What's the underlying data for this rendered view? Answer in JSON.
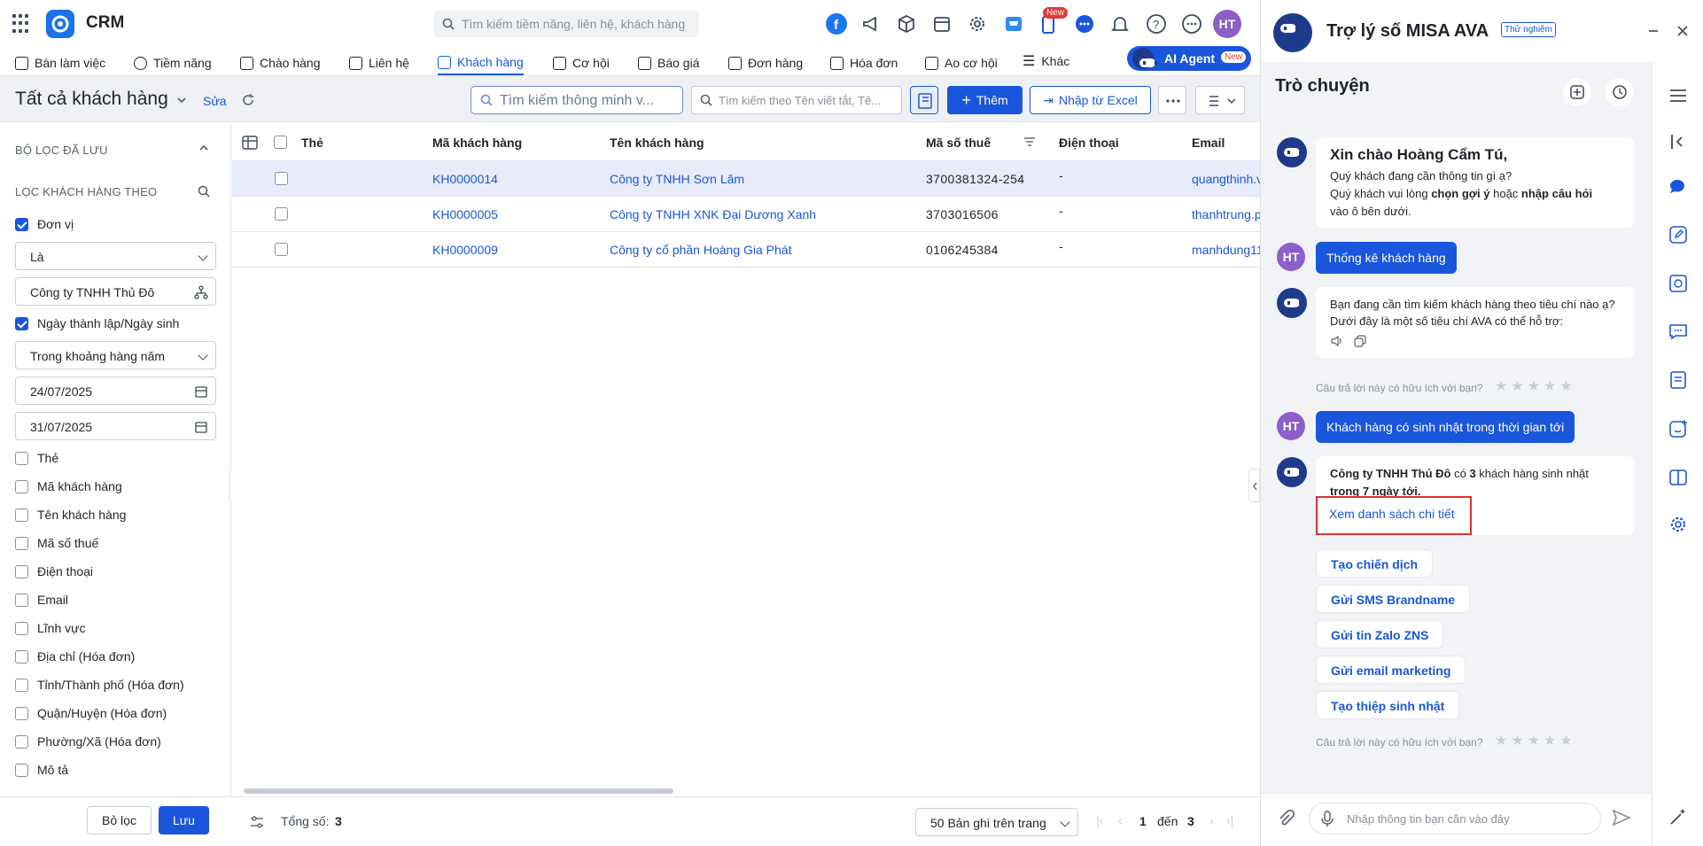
{
  "header": {
    "app_name": "CRM",
    "search_placeholder": "Tìm kiếm tiềm năng, liên hệ, khách hàng",
    "new_badge": "New",
    "avatar_initials": "HT"
  },
  "nav": {
    "items": [
      {
        "label": "Bàn làm việc"
      },
      {
        "label": "Tiềm năng"
      },
      {
        "label": "Chào hàng"
      },
      {
        "label": "Liên hệ"
      },
      {
        "label": "Khách hàng"
      },
      {
        "label": "Cơ hội"
      },
      {
        "label": "Báo giá"
      },
      {
        "label": "Đơn hàng"
      },
      {
        "label": "Hóa đơn"
      },
      {
        "label": "Ao cơ hội"
      },
      {
        "label": "Khác"
      }
    ],
    "active": "Khách hàng",
    "ai_agent_label": "AI Agent",
    "ai_agent_badge": "New"
  },
  "toolbar": {
    "title": "Tất cả khách hàng",
    "edit_label": "Sửa",
    "smart_search_placeholder": "Tìm kiếm thông minh v...",
    "search_placeholder": "Tìm kiếm theo Tên viết tắt, Tê...",
    "add_label": "Thêm",
    "import_label": "Nhập từ Excel"
  },
  "sidebar": {
    "saved_filters_title": "BỘ LỌC ĐÃ LƯU",
    "filter_by_title": "LỌC KHÁCH HÀNG THEO",
    "unit_label": "Đơn vị",
    "unit_operator": "Là",
    "unit_value": "Công ty TNHH Thủ Đô",
    "date_label": "Ngày thành lập/Ngày sinh",
    "date_operator": "Trong khoảng hàng năm",
    "date_from": "24/07/2025",
    "date_to": "31/07/2025",
    "fields": [
      "Thẻ",
      "Mã khách hàng",
      "Tên khách hàng",
      "Mã số thuế",
      "Điện thoại",
      "Email",
      "Lĩnh vực",
      "Địa chỉ (Hóa đơn)",
      "Tỉnh/Thành phố (Hóa đơn)",
      "Quận/Huyện (Hóa đơn)",
      "Phường/Xã (Hóa đơn)",
      "Mô tả"
    ],
    "reset_label": "Bỏ lọc",
    "save_label": "Lưu"
  },
  "table": {
    "columns": [
      "Thẻ",
      "Mã khách hàng",
      "Tên khách hàng",
      "Mã số thuế",
      "Điện thoại",
      "Email"
    ],
    "rows": [
      {
        "code": "KH0000014",
        "name": "Công ty TNHH Sơn Lâm",
        "tax": "3700381324-254",
        "phone": "-",
        "email": "quangthinh.v"
      },
      {
        "code": "KH0000005",
        "name": "Công ty TNHH XNK Đại Dương Xanh",
        "tax": "3703016506",
        "phone": "-",
        "email": "thanhtrung.p"
      },
      {
        "code": "KH0000009",
        "name": "Công ty cổ phần Hoàng Gia Phát",
        "tax": "0106245384",
        "phone": "-",
        "email": "manhdung11"
      }
    ],
    "total_label": "Tổng số:",
    "total": "3",
    "page_size": "50 Bản ghi trên trang",
    "page_from": "1",
    "page_to_label": "đến",
    "page_to": "3"
  },
  "assistant": {
    "title": "Trợ lý số MISA AVA",
    "beta_badge": "Thử nghiệm",
    "section_title": "Trò chuyện",
    "greeting_title": "Xin chào Hoàng Cẩm Tú,",
    "greeting_line1": "Quý khách đang cần thông tin gì ạ?",
    "greeting_line2_a": "Quý khách vui lòng ",
    "greeting_line2_b": "chọn gợi ý",
    "greeting_line2_c": " hoặc ",
    "greeting_line2_d": "nhập câu hỏi",
    "greeting_line3": "vào ô bên dưới.",
    "user_msg1": "Thống kê khách hàng",
    "bot_msg1": "Bạn đang cần tìm kiếm khách hàng theo tiêu chí nào ạ? Dưới đây là một số tiêu chí AVA có thể hỗ trợ:",
    "rating_question": "Câu trả lời này có hữu ích với bạn?",
    "user_msg2": "Khách hàng có sinh nhật trong thời gian tới",
    "bot_msg2_company": "Công ty TNHH Thủ Đô",
    "bot_msg2_mid": " có ",
    "bot_msg2_count": "3",
    "bot_msg2_rest": " khách hàng sinh nhật",
    "bot_msg2_period": "trong 7 ngày tới",
    "view_list_link": "Xem danh sách chi tiết",
    "actions": [
      "Tạo chiến dịch",
      "Gửi SMS Brandname",
      "Gửi tin Zalo ZNS",
      "Gửi email marketing",
      "Tạo thiệp sinh nhật"
    ],
    "input_placeholder": "Nhập thông tin bạn cần vào đây",
    "user_initials": "HT"
  },
  "colors": {
    "primary": "#1a56db",
    "avatar": "#8e5ec9",
    "highlight_border": "#e03131"
  }
}
